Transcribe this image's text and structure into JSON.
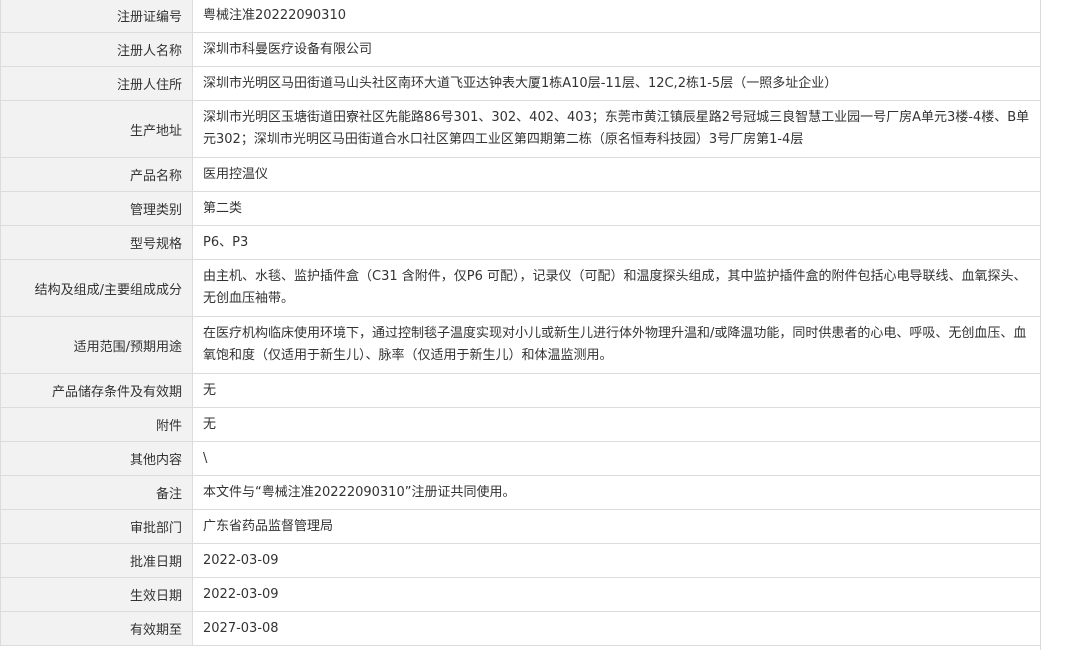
{
  "rows": [
    {
      "label": "注册证编号",
      "value": "粤械注准20222090310"
    },
    {
      "label": "注册人名称",
      "value": "深圳市科曼医疗设备有限公司"
    },
    {
      "label": "注册人住所",
      "value": "深圳市光明区马田街道马山头社区南环大道飞亚达钟表大厦1栋A10层-11层、12C,2栋1-5层（一照多址企业）"
    },
    {
      "label": "生产地址",
      "value": "深圳市光明区玉塘街道田寮社区先能路86号301、302、402、403；东莞市黄江镇辰星路2号冠城三良智慧工业园一号厂房A单元3楼-4楼、B单元302；深圳市光明区马田街道合水口社区第四工业区第四期第二栋（原名恒寿科技园）3号厂房第1-4层"
    },
    {
      "label": "产品名称",
      "value": "医用控温仪"
    },
    {
      "label": "管理类别",
      "value": "第二类"
    },
    {
      "label": "型号规格",
      "value": "P6、P3"
    },
    {
      "label": "结构及组成/主要组成成分",
      "value": "由主机、水毯、监护插件盒（C31 含附件，仅P6 可配），记录仪（可配）和温度探头组成，其中监护插件盒的附件包括心电导联线、血氧探头、无创血压袖带。"
    },
    {
      "label": "适用范围/预期用途",
      "value": "在医疗机构临床使用环境下，通过控制毯子温度实现对小儿或新生儿进行体外物理升温和/或降温功能，同时供患者的心电、呼吸、无创血压、血氧饱和度（仅适用于新生儿）、脉率（仅适用于新生儿）和体温监测用。"
    },
    {
      "label": "产品储存条件及有效期",
      "value": "无"
    },
    {
      "label": "附件",
      "value": "无"
    },
    {
      "label": "其他内容",
      "value": "\\"
    },
    {
      "label": "备注",
      "value": "本文件与“粤械注准20222090310”注册证共同使用。"
    },
    {
      "label": "审批部门",
      "value": "广东省药品监督管理局"
    },
    {
      "label": "批准日期",
      "value": "2022-03-09"
    },
    {
      "label": "生效日期",
      "value": "2022-03-09"
    },
    {
      "label": "有效期至",
      "value": "2027-03-08"
    }
  ]
}
